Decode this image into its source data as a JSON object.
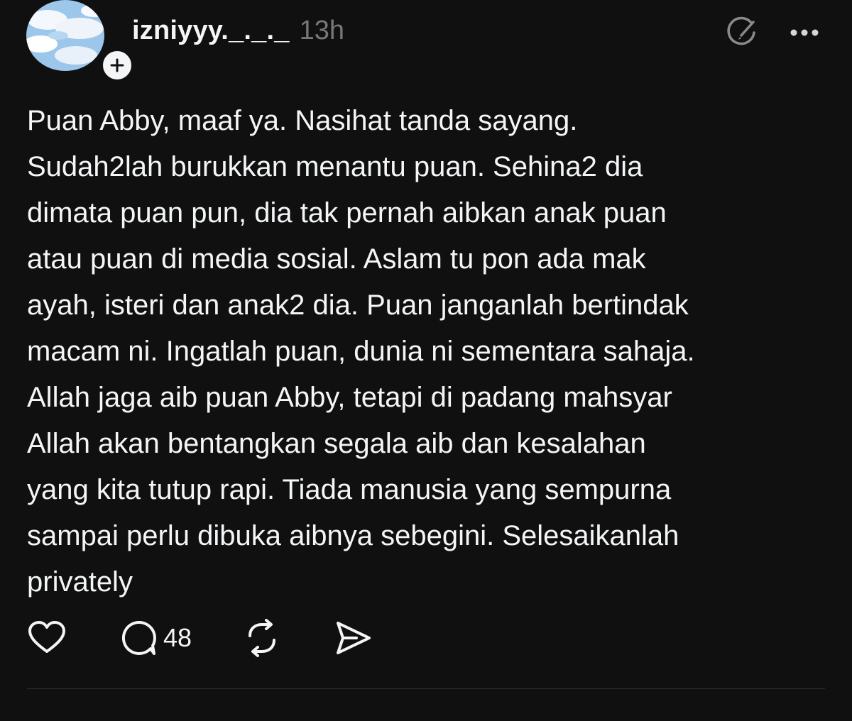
{
  "post": {
    "author": {
      "username": "izniyyy._._._",
      "avatar_icon": "sky-avatar",
      "follow_icon": "plus-icon"
    },
    "timestamp": "13h",
    "top_icons": {
      "left": "edit-circle-icon",
      "right": "more-icon"
    },
    "body": "Puan Abby, maaf ya. Nasihat tanda sayang.\nSudah2lah burukkan menantu puan. Sehina2 dia\ndimata puan pun, dia tak pernah aibkan anak puan\natau puan di media sosial. Aslam tu pon ada mak\nayah, isteri dan anak2 dia. Puan janganlah bertindak\nmacam ni. Ingatlah puan, dunia ni sementara sahaja.\nAllah jaga aib puan Abby, tetapi di padang mahsyar\nAllah akan bentangkan segala aib dan kesalahan\nyang kita tutup rapi. Tiada manusia yang sempurna\nsampai perlu dibuka aibnya sebegini. Selesaikanlah\nprivately",
    "actions": {
      "like_icon": "heart-icon",
      "reply_icon": "comment-icon",
      "reply_count": "48",
      "repost_icon": "repost-icon",
      "share_icon": "share-icon"
    }
  },
  "colors": {
    "background": "#101010",
    "text": "#f3f5f7",
    "muted": "#777777",
    "divider": "#2e2e2e"
  }
}
